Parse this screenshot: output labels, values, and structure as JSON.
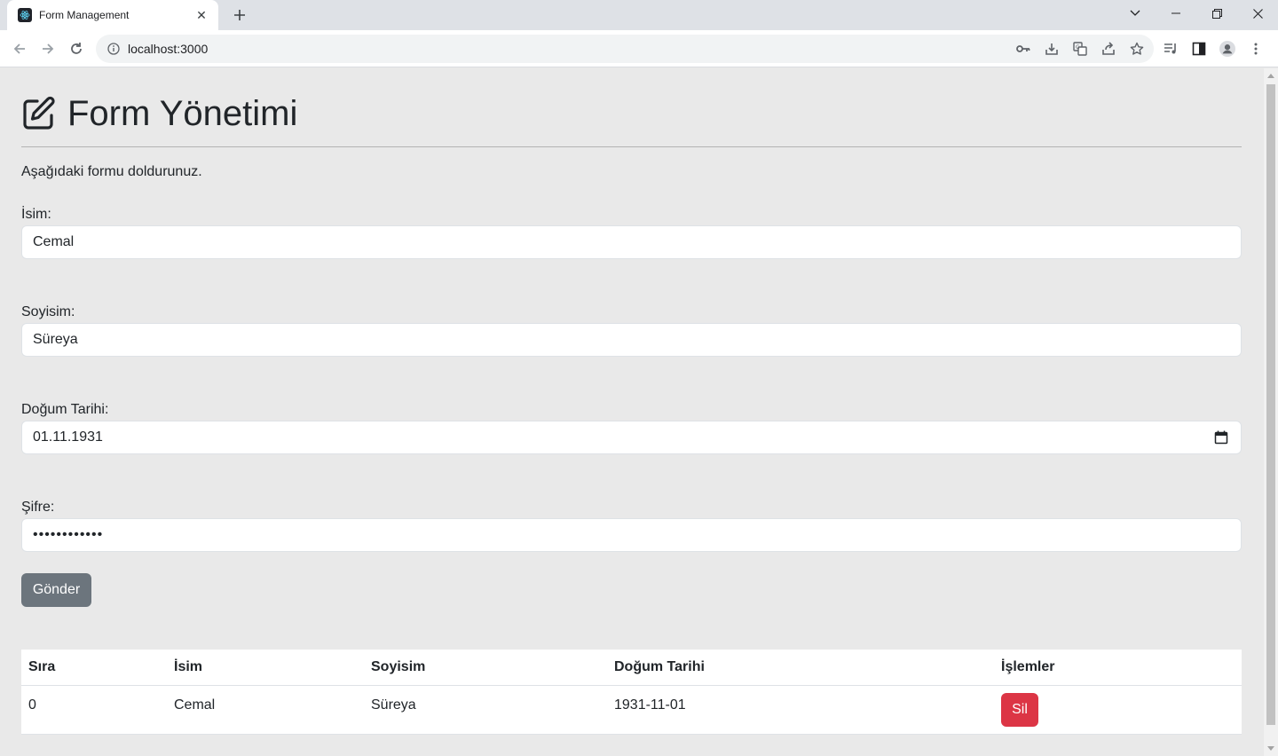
{
  "browser": {
    "tab_title": "Form Management",
    "url": "localhost:3000"
  },
  "page": {
    "title": "Form Yönetimi",
    "intro": "Aşağıdaki formu doldurunuz.",
    "form": {
      "name_label": "İsim:",
      "name_value": "Cemal",
      "surname_label": "Soyisim:",
      "surname_value": "Süreya",
      "birth_label": "Doğum Tarihi:",
      "birth_value": "01.11.1931",
      "password_label": "Şifre:",
      "password_value": "••••••••••••",
      "submit_label": "Gönder"
    },
    "table": {
      "headers": [
        "Sıra",
        "İsim",
        "Soyisim",
        "Doğum Tarihi",
        "İşlemler"
      ],
      "rows": [
        {
          "index": "0",
          "name": "Cemal",
          "surname": "Süreya",
          "birth": "1931-11-01",
          "delete_label": "Sil"
        }
      ]
    }
  },
  "colors": {
    "submit": "#6c757d",
    "delete": "#dc3545",
    "page_bg": "#e9e9e9"
  }
}
